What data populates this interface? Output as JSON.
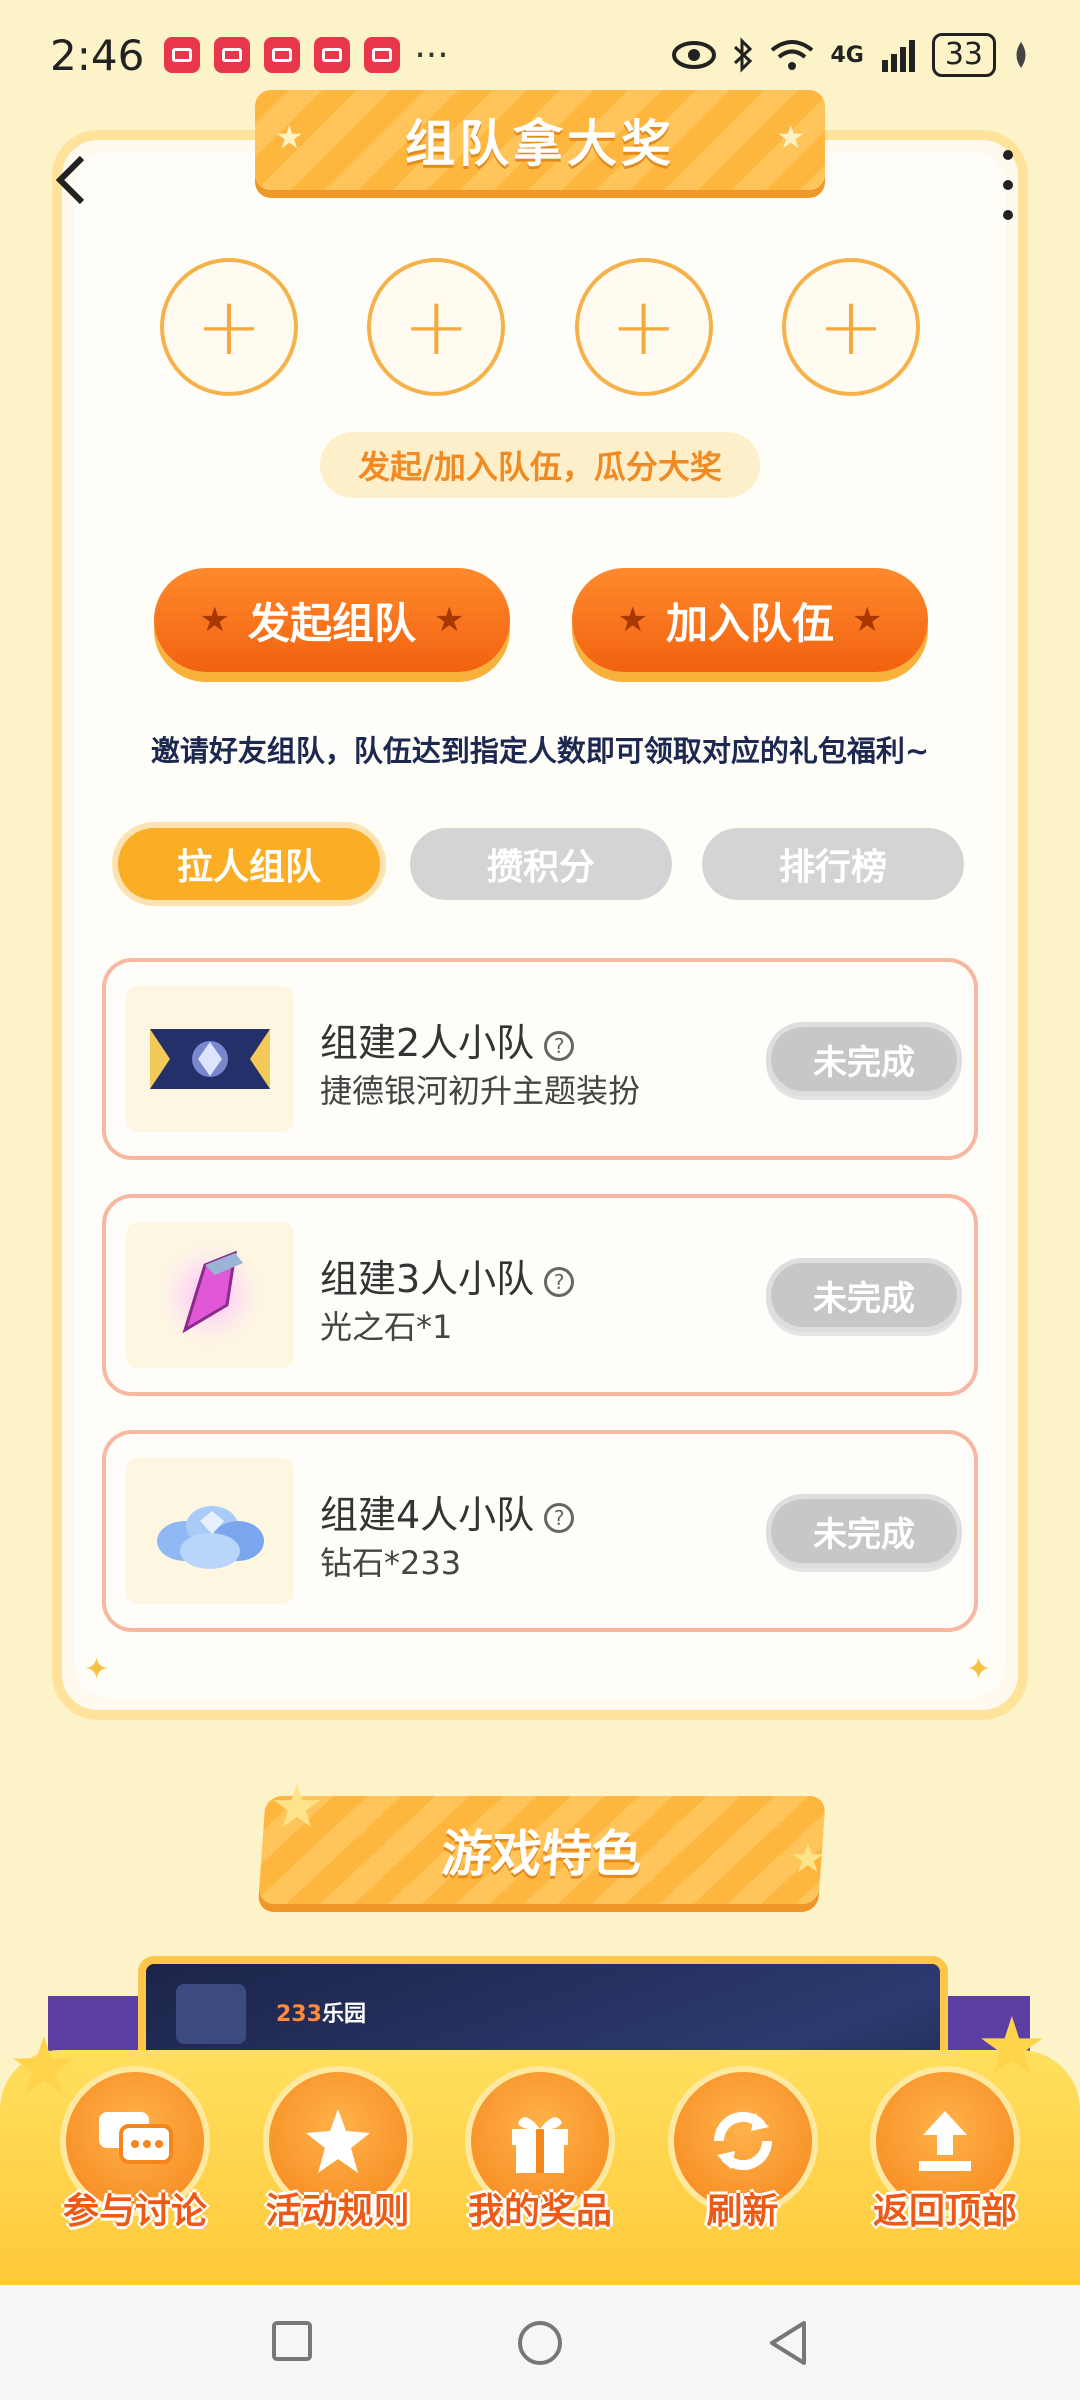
{
  "status_bar": {
    "time": "2:46",
    "more": "···",
    "network": "4G",
    "battery": "33"
  },
  "header": {
    "title": "组队拿大奖",
    "back_icon": "chevron-left-icon",
    "more_icon": "vertical-dots-icon"
  },
  "team": {
    "slot_symbol": "+",
    "slogan": "发起/加入队伍，瓜分大奖",
    "start_label": "发起组队",
    "join_label": "加入队伍",
    "invite_text": "邀请好友组队，队伍达到指定人数即可领取对应的礼包福利~"
  },
  "tabs": [
    {
      "label": "拉人组队",
      "active": true
    },
    {
      "label": "攒积分",
      "active": false
    },
    {
      "label": "排行榜",
      "active": false
    }
  ],
  "tasks": [
    {
      "title": "组建2人小队",
      "reward": "捷德银河初升主题装扮",
      "status": "未完成",
      "icon": "theme-badge-icon"
    },
    {
      "title": "组建3人小队",
      "reward": "光之石*1",
      "status": "未完成",
      "icon": "crystal-icon"
    },
    {
      "title": "组建4人小队",
      "reward": "钻石*233",
      "status": "未完成",
      "icon": "diamond-pile-icon"
    }
  ],
  "features": {
    "title": "游戏特色",
    "brand_prefix": "233",
    "brand_suffix": "乐园"
  },
  "bottom_nav": [
    {
      "label": "参与讨论",
      "icon": "chat-icon"
    },
    {
      "label": "活动规则",
      "icon": "rules-icon"
    },
    {
      "label": "我的奖品",
      "icon": "gift-icon"
    },
    {
      "label": "刷新",
      "icon": "refresh-icon"
    },
    {
      "label": "返回顶部",
      "icon": "upload-top-icon"
    }
  ],
  "colors": {
    "accent": "#f2620f",
    "gold": "#fbad26",
    "background": "#fdf3c8"
  }
}
